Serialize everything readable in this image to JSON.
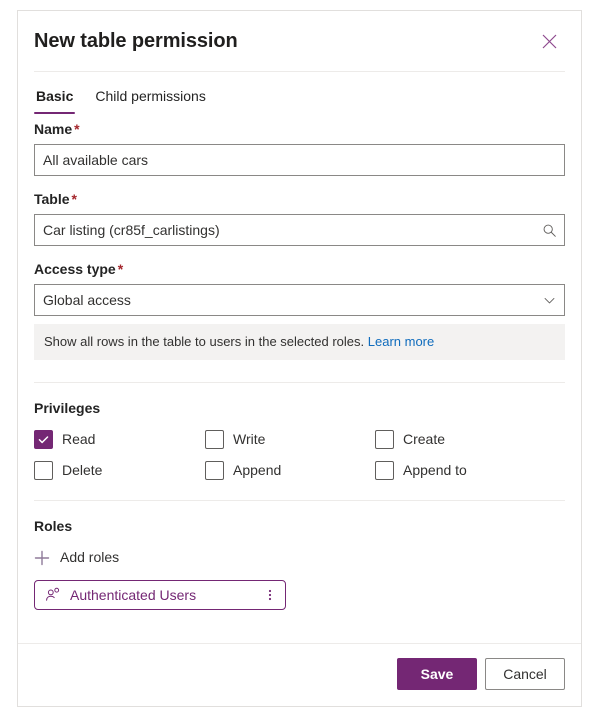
{
  "dialog": {
    "title": "New table permission",
    "close_icon": "close-icon",
    "accent_color": "#742774",
    "link_color": "#0f6cbd",
    "required_color": "#a4262c"
  },
  "tabs": [
    {
      "label": "Basic",
      "active": true
    },
    {
      "label": "Child permissions",
      "active": false
    }
  ],
  "fields": {
    "name": {
      "label": "Name",
      "required_marker": "*",
      "value": "All available cars",
      "placeholder": ""
    },
    "table": {
      "label": "Table",
      "required_marker": "*",
      "value": "Car listing (cr85f_carlistings)",
      "placeholder": "",
      "icon": "search-icon"
    },
    "access_type": {
      "label": "Access type",
      "required_marker": "*",
      "value": "Global access",
      "icon": "chevron-down-icon",
      "options": [
        "Global access"
      ]
    }
  },
  "info": {
    "text": "Show all rows in the table to users in the selected roles.",
    "link_label": "Learn more"
  },
  "privileges": {
    "title": "Privileges",
    "items": [
      {
        "label": "Read",
        "checked": true
      },
      {
        "label": "Write",
        "checked": false
      },
      {
        "label": "Create",
        "checked": false
      },
      {
        "label": "Delete",
        "checked": false
      },
      {
        "label": "Append",
        "checked": false
      },
      {
        "label": "Append to",
        "checked": false
      }
    ]
  },
  "roles": {
    "title": "Roles",
    "add_label": "Add roles",
    "add_icon": "plus-icon",
    "chips": [
      {
        "label": "Authenticated Users",
        "icon": "person-role-icon",
        "menu_icon": "more-vertical-icon"
      }
    ]
  },
  "footer": {
    "save_label": "Save",
    "cancel_label": "Cancel"
  }
}
